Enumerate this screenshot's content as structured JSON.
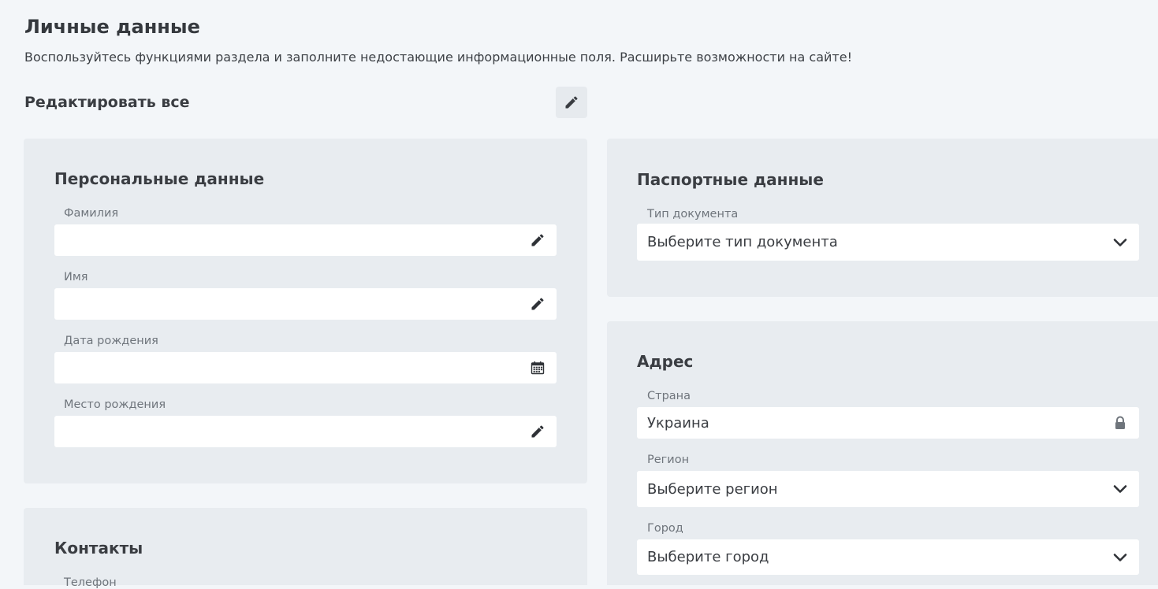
{
  "header": {
    "title": "Личные данные",
    "subtitle": "Воспользуйтесь функциями раздела и заполните недостающие информационные поля. Расширьте возможности на сайте!",
    "edit_all_label": "Редактировать все",
    "edit_all_icon": "pencil-icon"
  },
  "personal": {
    "title": "Персональные данные",
    "fields": [
      {
        "label": "Фамилия",
        "value": "",
        "icon": "pencil-icon"
      },
      {
        "label": "Имя",
        "value": "",
        "icon": "pencil-icon"
      },
      {
        "label": "Дата рождения",
        "value": "",
        "icon": "calendar-icon"
      },
      {
        "label": "Место рождения",
        "value": "",
        "icon": "pencil-icon"
      }
    ]
  },
  "contacts": {
    "title": "Контакты",
    "fields": [
      {
        "label": "Телефон"
      }
    ]
  },
  "passport": {
    "title": "Паспортные данные",
    "fields": [
      {
        "label": "Тип документа",
        "value": "Выберите тип документа",
        "icon": "chevron-down-icon"
      }
    ]
  },
  "address": {
    "title": "Адрес",
    "fields": [
      {
        "label": "Страна",
        "value": "Украина",
        "icon": "lock-icon"
      },
      {
        "label": "Регион",
        "value": "Выберите регион",
        "icon": "chevron-down-icon"
      },
      {
        "label": "Город",
        "value": "Выберите город",
        "icon": "chevron-down-icon"
      }
    ]
  },
  "colors": {
    "page_bg": "#f3f6f9",
    "card_bg": "#e8ecf0",
    "field_bg": "#ffffff",
    "text": "#3a3d42",
    "label": "#6f757c"
  }
}
